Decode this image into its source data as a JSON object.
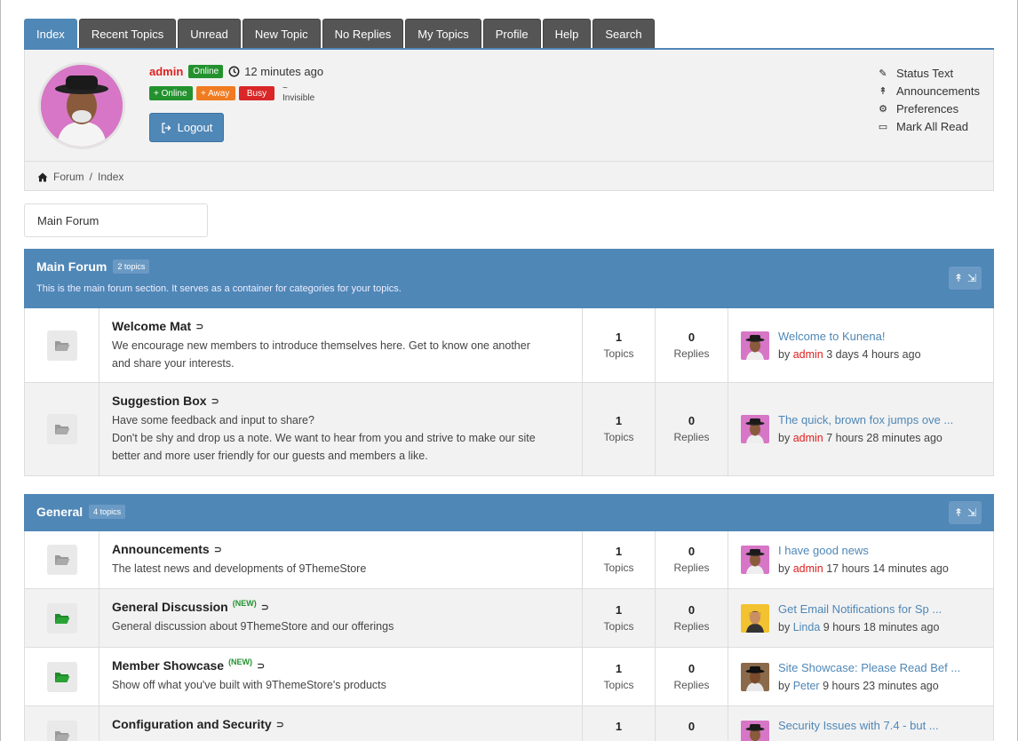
{
  "tabs": [
    "Index",
    "Recent Topics",
    "Unread",
    "New Topic",
    "No Replies",
    "My Topics",
    "Profile",
    "Help",
    "Search"
  ],
  "user": {
    "name": "admin",
    "online_badge": "Online",
    "last_seen": "12 minutes ago",
    "status_options": [
      "+ Online",
      "+ Away",
      "Busy",
      "~ Invisible"
    ],
    "logout_label": "Logout"
  },
  "right_menu": [
    {
      "icon": "edit-icon",
      "label": "Status Text"
    },
    {
      "icon": "pin-icon",
      "label": "Announcements"
    },
    {
      "icon": "cogs-icon",
      "label": "Preferences"
    },
    {
      "icon": "inbox-icon",
      "label": "Mark All Read"
    }
  ],
  "breadcrumb": {
    "home": "Forum",
    "sep": "/",
    "current": "Index"
  },
  "forum_select": "Main Forum",
  "categories": [
    {
      "title": "Main Forum",
      "count": "2 topics",
      "description": "This is the main forum section. It serves as a container for categories for your topics.",
      "forums": [
        {
          "title": "Welcome Mat",
          "is_new": false,
          "desc": [
            "We encourage new members to introduce themselves here. Get to know one another",
            "and share your interests."
          ],
          "topics": "1",
          "topics_label": "Topics",
          "replies": "0",
          "replies_label": "Replies",
          "last_topic": "Welcome to Kunena!",
          "by_prefix": "by",
          "by_user": "admin",
          "by_time": "3 days 4 hours ago"
        },
        {
          "title": "Suggestion Box",
          "is_new": false,
          "desc": [
            "Have some feedback and input to share?",
            "Don't be shy and drop us a note. We want to hear from you and strive to make our site",
            "better and more user friendly for our guests and members a like."
          ],
          "topics": "1",
          "topics_label": "Topics",
          "replies": "0",
          "replies_label": "Replies",
          "last_topic": "The quick, brown fox jumps ove ...",
          "by_prefix": "by",
          "by_user": "admin",
          "by_time": "7 hours 28 minutes ago"
        }
      ]
    },
    {
      "title": "General",
      "count": "4 topics",
      "description": "",
      "forums": [
        {
          "title": "Announcements",
          "is_new": false,
          "desc": [
            "The latest news and developments of 9ThemeStore"
          ],
          "topics": "1",
          "topics_label": "Topics",
          "replies": "0",
          "replies_label": "Replies",
          "last_topic": "I have good news",
          "by_prefix": "by",
          "by_user": "admin",
          "by_time": "17 hours 14 minutes ago"
        },
        {
          "title": "General Discussion",
          "is_new": true,
          "new_label": "(NEW)",
          "desc": [
            "General discussion about 9ThemeStore and our offerings"
          ],
          "topics": "1",
          "topics_label": "Topics",
          "replies": "0",
          "replies_label": "Replies",
          "last_topic": "Get Email Notifications for Sp ...",
          "by_prefix": "by",
          "by_user": "Linda",
          "by_time": "9 hours 18 minutes ago"
        },
        {
          "title": "Member Showcase",
          "is_new": true,
          "new_label": "(NEW)",
          "desc": [
            "Show off what you've built with 9ThemeStore's products"
          ],
          "topics": "1",
          "topics_label": "Topics",
          "replies": "0",
          "replies_label": "Replies",
          "last_topic": "Site Showcase: Please Read Bef ...",
          "by_prefix": "by",
          "by_user": "Peter",
          "by_time": "9 hours 23 minutes ago"
        },
        {
          "title": "Configuration and Security",
          "is_new": false,
          "desc": [],
          "topics": "1",
          "topics_label": "",
          "replies": "0",
          "replies_label": "",
          "last_topic": "Security Issues with 7.4 - but ...",
          "by_prefix": "",
          "by_user": "",
          "by_time": ""
        }
      ]
    }
  ],
  "colors": {
    "accent": "#4f87b7",
    "tab_dark": "#555555",
    "online": "#23922e",
    "away": "#f07b20",
    "busy": "#d92626",
    "admin": "#e02020",
    "new_green": "#23922e"
  }
}
